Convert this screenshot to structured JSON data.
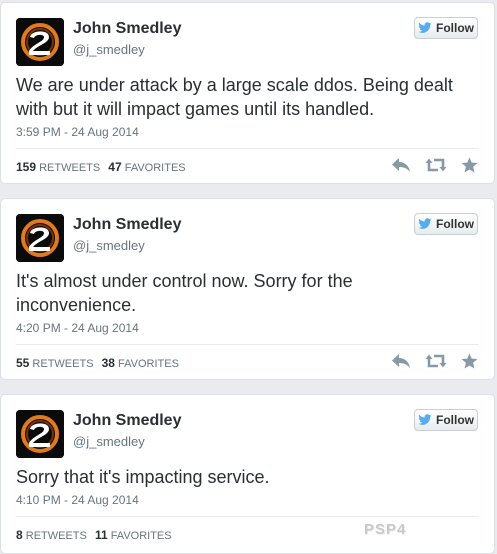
{
  "watermark": "PSP4",
  "follow_label": "Follow",
  "stats_labels": {
    "retweets": "RETWEETS",
    "favorites": "FAVORITES"
  },
  "icons": [
    "logo-2-icon",
    "twitter-bird-icon",
    "reply-icon",
    "retweet-icon",
    "favorite-star-icon"
  ],
  "colors": {
    "twitter_blue": "#55acee",
    "action_gray": "#8899a6",
    "card_border": "#dcdfe3"
  },
  "tweets": [
    {
      "name": "John Smedley",
      "handle": "@j_smedley",
      "text": "We are under attack by a large scale ddos. Being dealt with but it will impact games until its handled.",
      "time": "3:59 PM - 24 Aug 2014",
      "retweets": "159",
      "favorites": "47"
    },
    {
      "name": "John Smedley",
      "handle": "@j_smedley",
      "text": "It's almost under control now. Sorry for the inconvenience.",
      "time": "4:20 PM - 24 Aug 2014",
      "retweets": "55",
      "favorites": "38"
    },
    {
      "name": "John Smedley",
      "handle": "@j_smedley",
      "text": "Sorry that it's impacting service.",
      "time": "4:10 PM - 24 Aug 2014",
      "retweets": "8",
      "favorites": "11"
    }
  ]
}
